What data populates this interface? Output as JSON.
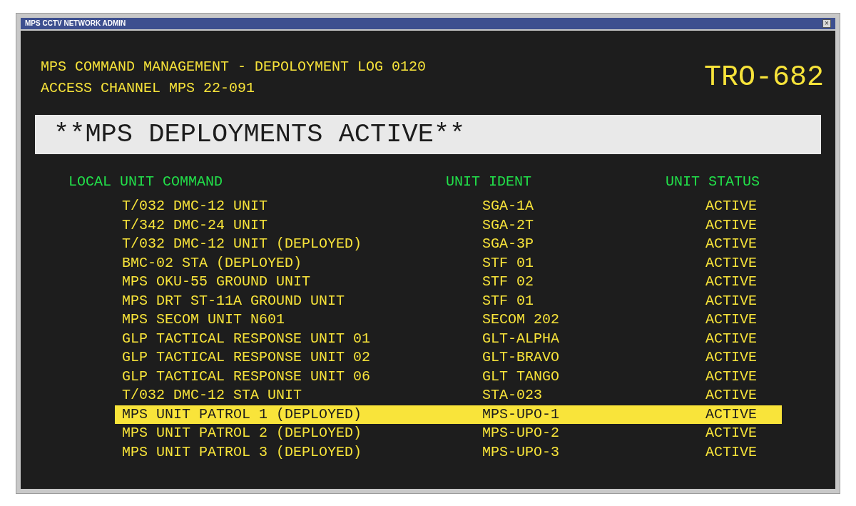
{
  "window": {
    "title": "MPS CCTV NETWORK ADMIN",
    "close": "×"
  },
  "header": {
    "line_1": "MPS COMMAND MANAGEMENT - DEPOLOYMENT LOG 0120",
    "line_2": "ACCESS CHANNEL MPS 22-091",
    "code": "TRO-682"
  },
  "banner": "**MPS DEPLOYMENTS ACTIVE**",
  "table": {
    "columns": [
      "LOCAL UNIT COMMAND",
      "UNIT IDENT",
      "UNIT STATUS"
    ],
    "rows": [
      {
        "unit": "T/032 DMC-12 UNIT",
        "ident": "SGA-1A",
        "status": "ACTIVE",
        "selected": false
      },
      {
        "unit": "T/342 DMC-24 UNIT",
        "ident": "SGA-2T",
        "status": "ACTIVE",
        "selected": false
      },
      {
        "unit": "T/032 DMC-12 UNIT (DEPLOYED)",
        "ident": "SGA-3P",
        "status": "ACTIVE",
        "selected": false
      },
      {
        "unit": "BMC-02 STA (DEPLOYED)",
        "ident": "STF 01",
        "status": "ACTIVE",
        "selected": false
      },
      {
        "unit": "MPS OKU-55 GROUND UNIT",
        "ident": "STF 02",
        "status": "ACTIVE",
        "selected": false
      },
      {
        "unit": "MPS DRT ST-11A GROUND UNIT",
        "ident": "STF 01",
        "status": "ACTIVE",
        "selected": false
      },
      {
        "unit": "MPS SECOM UNIT N601",
        "ident": "SECOM 202",
        "status": "ACTIVE",
        "selected": false
      },
      {
        "unit": "GLP TACTICAL RESPONSE UNIT 01",
        "ident": "GLT-ALPHA",
        "status": "ACTIVE",
        "selected": false
      },
      {
        "unit": "GLP TACTICAL RESPONSE UNIT 02",
        "ident": "GLT-BRAVO",
        "status": "ACTIVE",
        "selected": false
      },
      {
        "unit": "GLP TACTICAL RESPONSE UNIT 06",
        "ident": "GLT TANGO",
        "status": "ACTIVE",
        "selected": false
      },
      {
        "unit": "T/032 DMC-12 STA UNIT",
        "ident": "STA-023",
        "status": "ACTIVE",
        "selected": false
      },
      {
        "unit": "MPS UNIT PATROL 1 (DEPLOYED)",
        "ident": "MPS-UPO-1",
        "status": "ACTIVE",
        "selected": true
      },
      {
        "unit": "MPS UNIT PATROL 2 (DEPLOYED)",
        "ident": "MPS-UPO-2",
        "status": "ACTIVE",
        "selected": false
      },
      {
        "unit": "MPS UNIT PATROL 3 (DEPLOYED)",
        "ident": "MPS-UPO-3",
        "status": "ACTIVE",
        "selected": false
      }
    ]
  }
}
